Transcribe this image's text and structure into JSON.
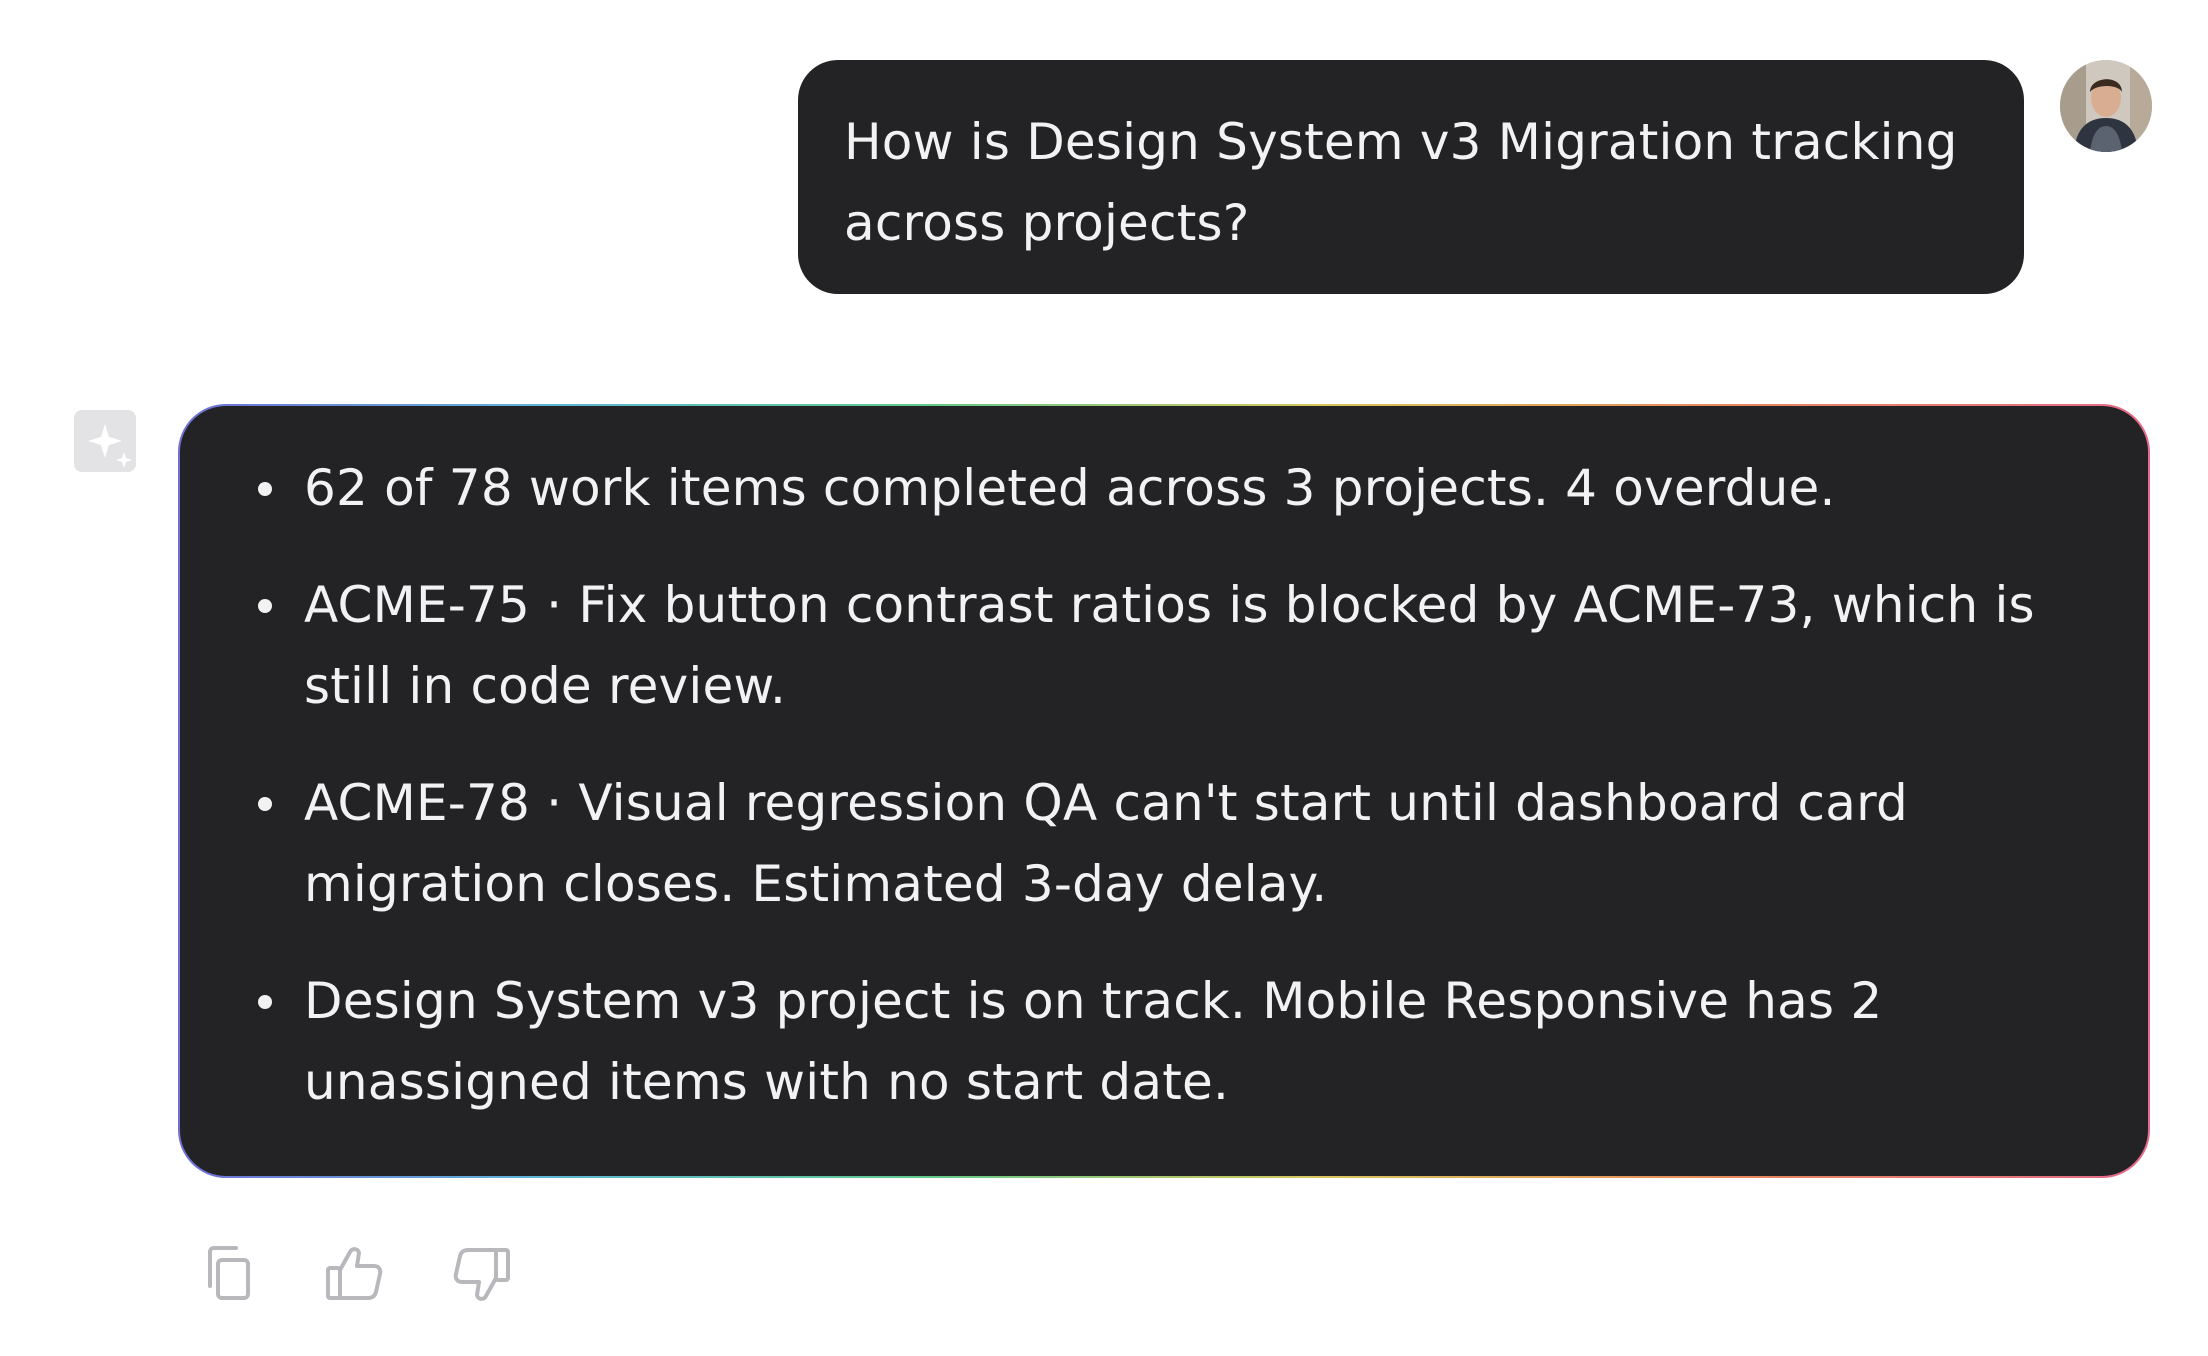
{
  "conversation": {
    "user_message": {
      "text": "How is Design System v3 Migration tracking across projects?",
      "avatar_icon": "user-avatar-photo"
    },
    "assistant_message": {
      "icon": "sparkle-assistant-icon",
      "items": [
        "62 of 78 work items completed across 3 projects. 4 overdue.",
        "ACME-75 · Fix button contrast ratios is blocked by ACME-73, which is still in code review.",
        "ACME-78 · Visual regression QA can't start until dashboard card migration closes. Estimated 3-day delay.",
        "Design System v3 project is on track. Mobile Responsive has 2 unassigned items with no start date."
      ]
    },
    "actions": [
      {
        "icon": "copy-icon"
      },
      {
        "icon": "thumbs-up-icon"
      },
      {
        "icon": "thumbs-down-icon"
      }
    ]
  },
  "colors": {
    "bubble_bg": "#232326",
    "bubble_text": "#f2f2f3",
    "page_bg": "#ffffff",
    "icon_gray": "#b8b8bc"
  }
}
